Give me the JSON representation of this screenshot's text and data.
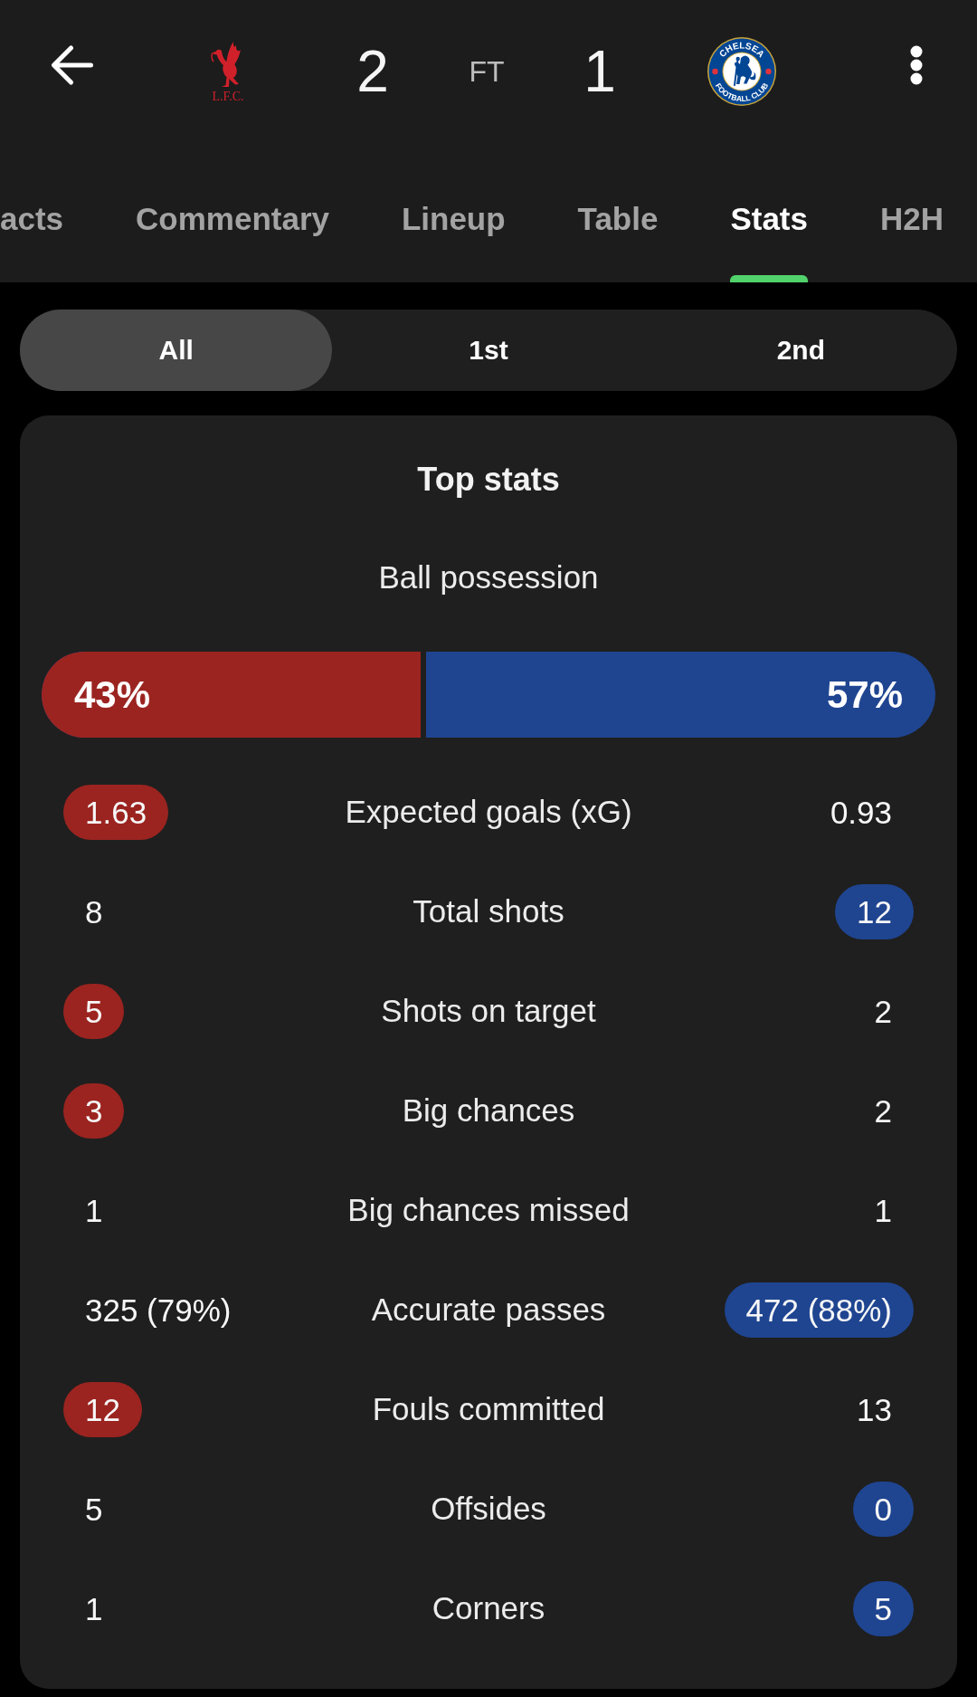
{
  "header": {
    "teams": [
      {
        "kind": "bird",
        "logo_texts": [
          "L.F.C."
        ],
        "score": "2",
        "color": "#9b2420"
      },
      {
        "kind": "crest",
        "logo_texts": [
          "CHELSEA",
          "FOOTBALL CLUB"
        ],
        "score": "1",
        "color": "#1f4591"
      }
    ],
    "status": "FT"
  },
  "tabs": [
    {
      "label": "acts",
      "selected": false
    },
    {
      "label": "Commentary",
      "selected": false
    },
    {
      "label": "Lineup",
      "selected": false
    },
    {
      "label": "Table",
      "selected": false
    },
    {
      "label": "Stats",
      "selected": true
    },
    {
      "label": "H2H",
      "selected": false
    }
  ],
  "periods": [
    {
      "label": "All",
      "selected": true
    },
    {
      "label": "1st",
      "selected": false
    },
    {
      "label": "2nd",
      "selected": false
    }
  ],
  "top_stats": {
    "title": "Top stats",
    "possession": {
      "label": "Ball possession",
      "home": "43%",
      "away": "57%",
      "level": 0.43
    },
    "rows": [
      {
        "label": "Expected goals (xG)",
        "home": "1.63",
        "away": "0.93",
        "home_highlighted": true,
        "away_highlighted": false
      },
      {
        "label": "Total shots",
        "home": "8",
        "away": "12",
        "home_highlighted": false,
        "away_highlighted": true
      },
      {
        "label": "Shots on target",
        "home": "5",
        "away": "2",
        "home_highlighted": true,
        "away_highlighted": false
      },
      {
        "label": "Big chances",
        "home": "3",
        "away": "2",
        "home_highlighted": true,
        "away_highlighted": false
      },
      {
        "label": "Big chances missed",
        "home": "1",
        "away": "1",
        "home_highlighted": false,
        "away_highlighted": false
      },
      {
        "label": "Accurate passes",
        "home": "325 (79%)",
        "away": "472 (88%)",
        "home_highlighted": false,
        "away_highlighted": true
      },
      {
        "label": "Fouls committed",
        "home": "12",
        "away": "13",
        "home_highlighted": true,
        "away_highlighted": false
      },
      {
        "label": "Offsides",
        "home": "5",
        "away": "0",
        "home_highlighted": false,
        "away_highlighted": true
      },
      {
        "label": "Corners",
        "home": "1",
        "away": "5",
        "home_highlighted": false,
        "away_highlighted": true
      }
    ]
  }
}
